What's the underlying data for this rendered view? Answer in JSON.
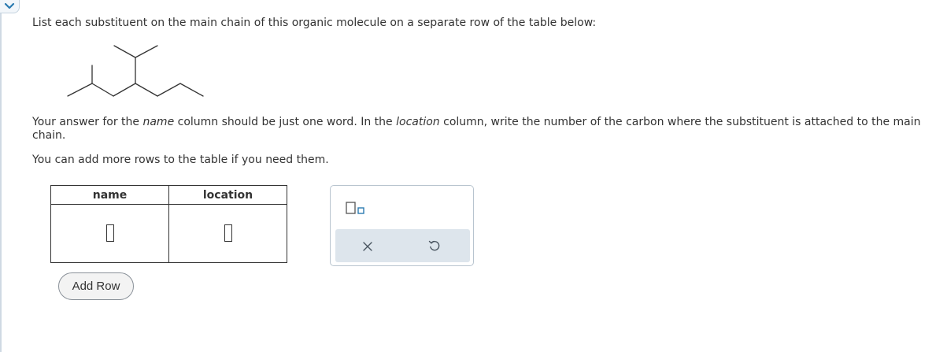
{
  "prompt": "List each substituent on the main chain of this organic molecule on a separate row of the table below:",
  "instructions": {
    "part1": "Your answer for the ",
    "name_word": "name",
    "part2": " column should be just one word. In the ",
    "location_word": "location",
    "part3": " column, write the number of the carbon where the substituent is attached to the main chain."
  },
  "add_rows_note": "You can add more rows to the table if you need them.",
  "table": {
    "headers": [
      "name",
      "location"
    ],
    "rows": [
      {
        "name": "",
        "location": ""
      }
    ]
  },
  "add_row_button": "Add Row",
  "colors": {
    "accent": "#2a7ab0",
    "toolbar_bg": "#dde5ec",
    "border": "#b8c4cf"
  },
  "icons": {
    "collapse": "chevron-down-icon",
    "template": "superscript-box-icon",
    "clear": "close-icon",
    "undo": "undo-icon"
  }
}
